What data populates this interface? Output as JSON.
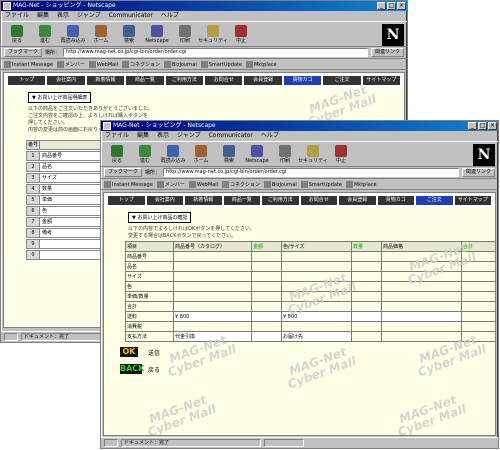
{
  "browser": {
    "title": "MAG-Net - ショッピング - Netscape",
    "menu": [
      "ファイル",
      "編集",
      "表示",
      "ジャンプ",
      "Communicator",
      "ヘルプ"
    ],
    "toolbar": [
      "戻る",
      "進む",
      "再読み込み",
      "ホーム",
      "検索",
      "Netscape",
      "印刷",
      "セキュリティ",
      "中止"
    ],
    "bookmarks_label": "ブックマーク",
    "location_label": "場所：",
    "url": "http://www.mag-net.co.jp/cgi-bin/order/order.cgi",
    "related_label": "関連リンク",
    "personal": [
      "Instant Message",
      "メンバー",
      "WebMail",
      "コネクション",
      "BizJournal",
      "SmartUpdate",
      "Mktplace"
    ],
    "logo": "N"
  },
  "back_window": {
    "header_box": "▼ お買い上げ商品明細表",
    "desc": [
      "以下の商品をご注文いただきありがとうございました。",
      "ご注文内容をご確認の上、よろしければ購入ボタンを",
      "押してください。",
      "内容の変更は前の画面にお戻りください。"
    ],
    "list_header": "番号",
    "rows": [
      {
        "num": "1",
        "name": "商品番号"
      },
      {
        "num": "2",
        "name": "品名"
      },
      {
        "num": "3",
        "name": "サイズ"
      },
      {
        "num": "4",
        "name": "数量"
      },
      {
        "num": "5",
        "name": "単価"
      },
      {
        "num": "6",
        "name": "色"
      },
      {
        "num": "7",
        "name": "金額"
      },
      {
        "num": "8",
        "name": "備考"
      },
      {
        "num": "9",
        "name": ""
      },
      {
        "num": "0",
        "name": ""
      }
    ]
  },
  "front_window": {
    "nav_tabs": [
      "トップ",
      "会社案内",
      "新着情報",
      "商品一覧",
      "ご利用方法",
      "お問合せ",
      "会員登録",
      "買物カゴ",
      "ご注文",
      "サイトマップ"
    ],
    "active_tab": "ご注文",
    "header_box": "▼ お買い上げ商品の確認",
    "desc": [
      "以下の内容でよろしければOKボタンを押してください。",
      "変更する場合はBACKボタンで戻ってください。"
    ],
    "table_headers": [
      "項目",
      "商品番号（カタログ）",
      "金額",
      "色/サイズ",
      "数量",
      "商品価格",
      "合計"
    ],
    "table_rows": [
      [
        "商品番号",
        "",
        "",
        "",
        "",
        "",
        ""
      ],
      [
        "品名",
        "",
        "",
        "",
        "",
        "",
        ""
      ],
      [
        "サイズ",
        "",
        "",
        "",
        "",
        "",
        ""
      ],
      [
        "色",
        "",
        "",
        "",
        "",
        "",
        ""
      ],
      [
        "単価/数量",
        "",
        "",
        "",
        "",
        "",
        ""
      ],
      [
        "合計",
        "",
        "",
        "",
        "",
        "",
        ""
      ],
      [
        "送料",
        "¥ 800",
        "",
        "¥ 800",
        "",
        "",
        ""
      ],
      [
        "消費税",
        "",
        "",
        "",
        "",
        "",
        ""
      ],
      [
        "支払方法",
        "代金引換",
        "",
        "お届け先",
        "",
        "",
        ""
      ]
    ],
    "ok_label": "OK",
    "ok_desc": "送信",
    "back_label": "BACK",
    "back_desc": "戻る"
  },
  "watermark": [
    "MAG-Net",
    "Cyber Mall"
  ],
  "status": {
    "text": "ドキュメント：完了"
  }
}
